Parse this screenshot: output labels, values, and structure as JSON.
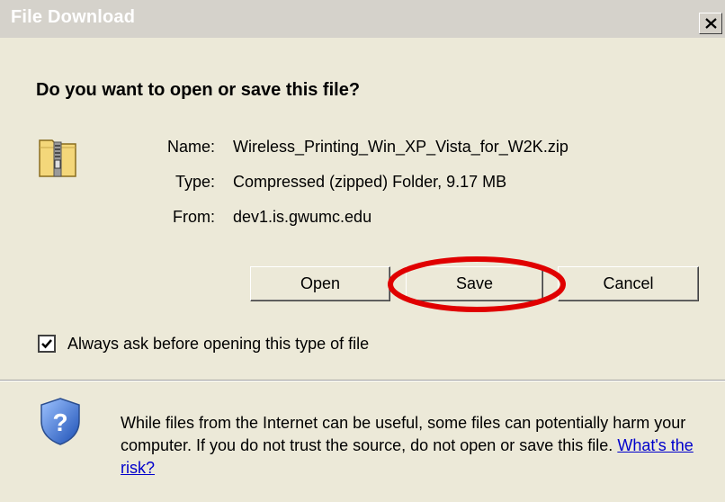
{
  "window": {
    "title": "File Download",
    "close_label": "×"
  },
  "prompt": {
    "heading": "Do you want to open or save this file?"
  },
  "file": {
    "name_label": "Name:",
    "name_value": "Wireless_Printing_Win_XP_Vista_for_W2K.zip",
    "type_label": "Type:",
    "type_value": "Compressed (zipped) Folder, 9.17 MB",
    "from_label": "From:",
    "from_value": "dev1.is.gwumc.edu",
    "icon": "zip-folder-icon"
  },
  "buttons": {
    "open": "Open",
    "save": "Save",
    "cancel": "Cancel"
  },
  "annotation": {
    "highlight_color": "#e00000"
  },
  "option": {
    "always_ask_label": "Always ask before opening this type of file",
    "always_ask_checked": true
  },
  "warning": {
    "text": "While files from the Internet can be useful, some files can potentially harm your computer. If you do not trust the source, do not open or save this file.",
    "link": "What's the risk?",
    "icon": "security-shield-icon"
  }
}
